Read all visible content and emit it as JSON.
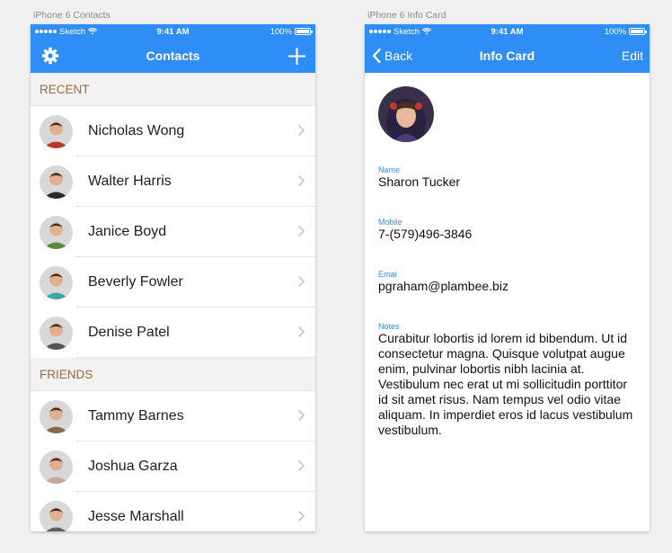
{
  "artboards": {
    "left_label": "iPhone 6 Contacts",
    "right_label": "iPhone 6 Info Card"
  },
  "status_bar": {
    "carrier": "Sketch",
    "time": "9:41 AM",
    "battery": "100%",
    "battery_level": 1.0
  },
  "contacts_screen": {
    "title": "Contacts",
    "settings_icon": "gear-icon",
    "add_icon": "plus-icon",
    "sections": [
      {
        "header": "RECENT",
        "contacts": [
          {
            "name": "Nicholas Wong",
            "avatar_color": "#b53a2e"
          },
          {
            "name": "Walter Harris",
            "avatar_color": "#2a2a2a"
          },
          {
            "name": "Janice Boyd",
            "avatar_color": "#5a8a3a"
          },
          {
            "name": "Beverly Fowler",
            "avatar_color": "#3aa8a0"
          },
          {
            "name": "Denise Patel",
            "avatar_color": "#555555"
          }
        ]
      },
      {
        "header": "FRIENDS",
        "contacts": [
          {
            "name": "Tammy Barnes",
            "avatar_color": "#8a6a4a"
          },
          {
            "name": "Joshua Garza",
            "avatar_color": "#c8a898"
          },
          {
            "name": "Jesse Marshall",
            "avatar_color": "#606060"
          }
        ]
      }
    ]
  },
  "info_screen": {
    "back_label": "Back",
    "title": "Info Card",
    "edit_label": "Edit",
    "fields": {
      "name_label": "Name",
      "name_value": "Sharon Tucker",
      "mobile_label": "Mobile",
      "mobile_value": "7-(579)496-3846",
      "email_label": "Emai",
      "email_value": "pgraham@plambee.biz",
      "notes_label": "Notes",
      "notes_value": "Curabitur lobortis id lorem id bibendum. Ut id consectetur magna. Quisque volutpat augue enim, pulvinar lobortis nibh lacinia at. Vestibulum nec erat ut mi sollicitudin porttitor id sit amet risus. Nam tempus vel odio vitae aliquam. In imperdiet eros id lacus vestibulum vestibulum."
    }
  },
  "colors": {
    "accent": "#2f8ef5",
    "section_text": "#9b6a46",
    "section_bg": "#f3f1f1",
    "chevron": "#c7c7cc"
  }
}
